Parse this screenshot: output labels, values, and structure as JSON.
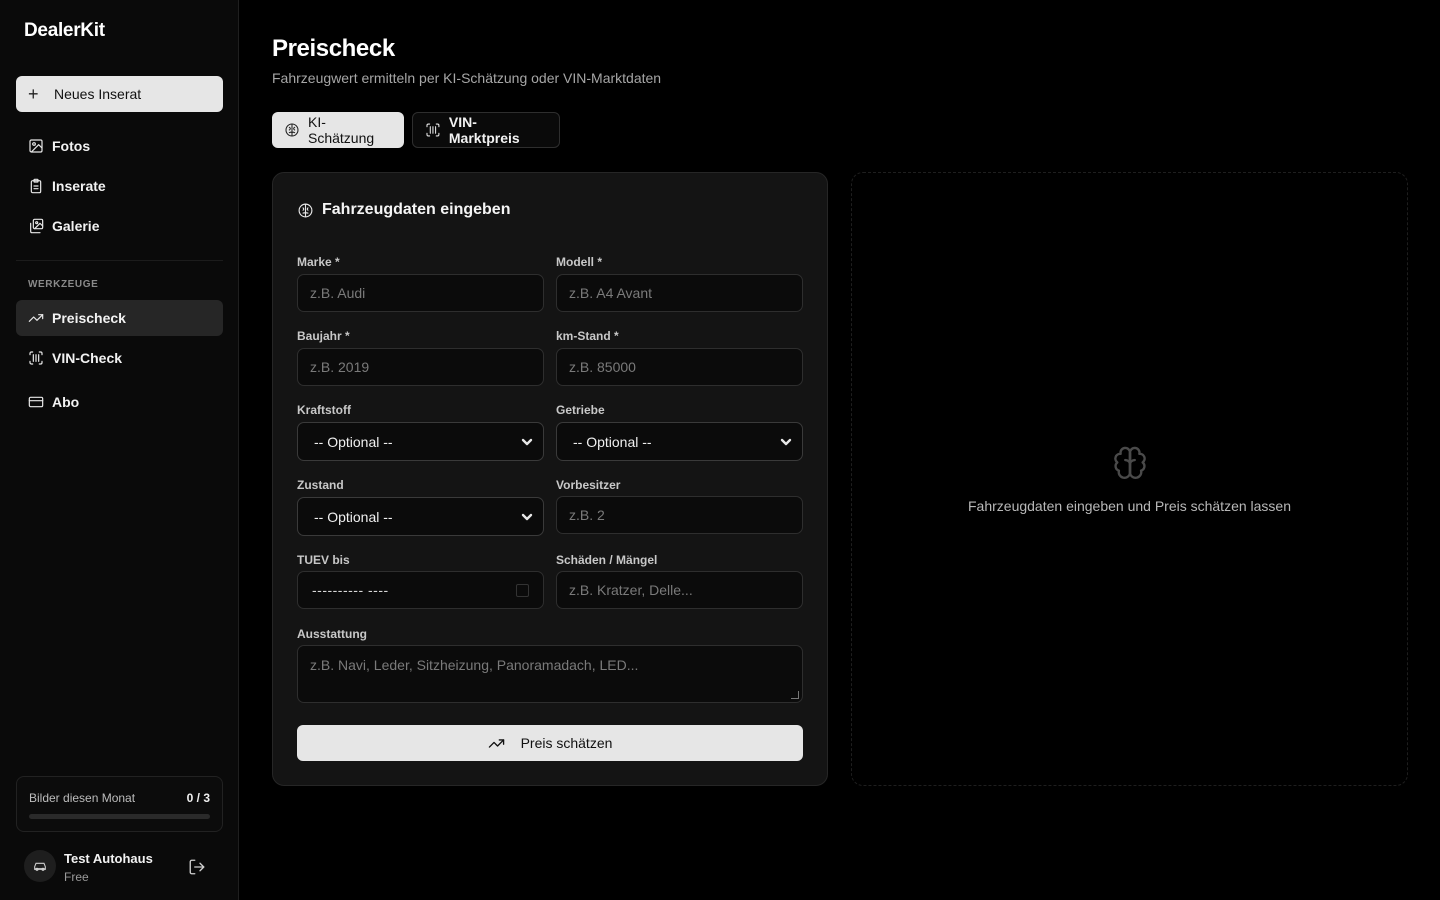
{
  "app": {
    "brand": "DealerKit"
  },
  "sidebar": {
    "new_button_label": "Neues Inserat",
    "items": [
      {
        "label": "Fotos",
        "icon": "image-icon"
      },
      {
        "label": "Inserate",
        "icon": "clipboard-icon"
      },
      {
        "label": "Galerie",
        "icon": "gallery-icon"
      }
    ],
    "tools_section_label": "WERKZEUGE",
    "tools": [
      {
        "label": "Preischeck",
        "icon": "trending-up-icon",
        "active": true
      },
      {
        "label": "VIN-Check",
        "icon": "scan-barcode-icon",
        "active": false
      },
      {
        "label": "Abo",
        "icon": "credit-card-icon",
        "active": false
      }
    ],
    "usage": {
      "label": "Bilder diesen Monat",
      "count": "0 / 3",
      "progress": 0
    },
    "user": {
      "name": "Test Autohaus",
      "plan": "Free"
    }
  },
  "main": {
    "title": "Preischeck",
    "subtitle": "Fahrzeugwert ermitteln per KI-Schätzung oder VIN-Marktdaten",
    "tabs": [
      {
        "label": "KI-Schätzung",
        "active": true
      },
      {
        "label": "VIN-Marktpreis",
        "active": false
      }
    ],
    "form": {
      "title": "Fahrzeugdaten eingeben",
      "fields": {
        "marke": {
          "label": "Marke *",
          "placeholder": "z.B. Audi"
        },
        "modell": {
          "label": "Modell *",
          "placeholder": "z.B. A4 Avant"
        },
        "baujahr": {
          "label": "Baujahr *",
          "placeholder": "z.B. 2019"
        },
        "km": {
          "label": "km-Stand *",
          "placeholder": "z.B. 85000"
        },
        "kraftstoff": {
          "label": "Kraftstoff",
          "value": "-- Optional --"
        },
        "getriebe": {
          "label": "Getriebe",
          "value": "-- Optional --"
        },
        "zustand": {
          "label": "Zustand",
          "value": "-- Optional --"
        },
        "vorbesitzer": {
          "label": "Vorbesitzer",
          "placeholder": "z.B. 2"
        },
        "tuev": {
          "label": "TUEV bis",
          "value": "---------- ----"
        },
        "schaeden": {
          "label": "Schäden / Mängel",
          "placeholder": "z.B. Kratzer, Delle..."
        },
        "ausstattung": {
          "label": "Ausstattung",
          "placeholder": "z.B. Navi, Leder, Sitzheizung, Panoramadach, LED..."
        }
      },
      "submit_label": "Preis schätzen"
    },
    "result": {
      "empty_text": "Fahrzeugdaten eingeben und Preis schätzen lassen"
    }
  },
  "colors": {
    "background": "#000000",
    "sidebar": "#0a0a0a",
    "card": "#141414",
    "accent": "#e6e6e6"
  }
}
